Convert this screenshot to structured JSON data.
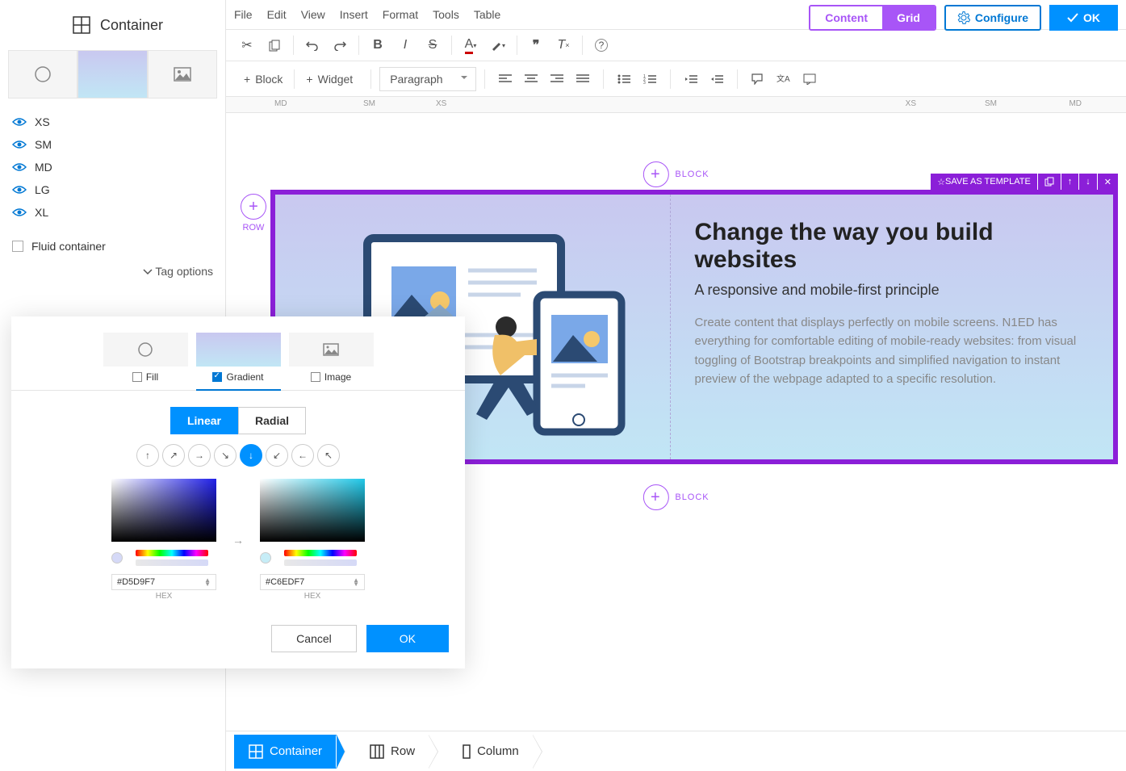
{
  "sidebar": {
    "title": "Container",
    "breakpoints": [
      "XS",
      "SM",
      "MD",
      "LG",
      "XL"
    ],
    "fluid_label": "Fluid container",
    "tag_options": "Tag options"
  },
  "menu": [
    "File",
    "Edit",
    "View",
    "Insert",
    "Format",
    "Tools",
    "Table"
  ],
  "top_right": {
    "content": "Content",
    "grid": "Grid",
    "configure": "Configure",
    "ok": "OK"
  },
  "toolbar2": {
    "block": "Block",
    "widget": "Widget",
    "paragraph": "Paragraph"
  },
  "ruler_labels": {
    "md1": "MD",
    "sm": "SM",
    "xs1": "XS",
    "xs2": "XS",
    "sm2": "SM",
    "md2": "MD"
  },
  "canvas": {
    "block_label": "BLOCK",
    "row_label": "ROW",
    "save_template": "SAVE AS TEMPLATE",
    "heading": "Change the way you build websites",
    "subheading": "A responsive and mobile-first principle",
    "body": "Create content that displays perfectly on mobile screens. N1ED has everything for comfortable editing of mobile-ready websites: from visual toggling of Bootstrap breakpoints and simplified navigation to instant preview of the webpage adapted to a specific resolution."
  },
  "breadcrumb": [
    "Container",
    "Row",
    "Column"
  ],
  "dialog": {
    "fill": "Fill",
    "gradient": "Gradient",
    "image": "Image",
    "linear": "Linear",
    "radial": "Radial",
    "hex1": "#D5D9F7",
    "hex2": "#C6EDF7",
    "hex_label": "HEX",
    "cancel": "Cancel",
    "ok": "OK"
  }
}
